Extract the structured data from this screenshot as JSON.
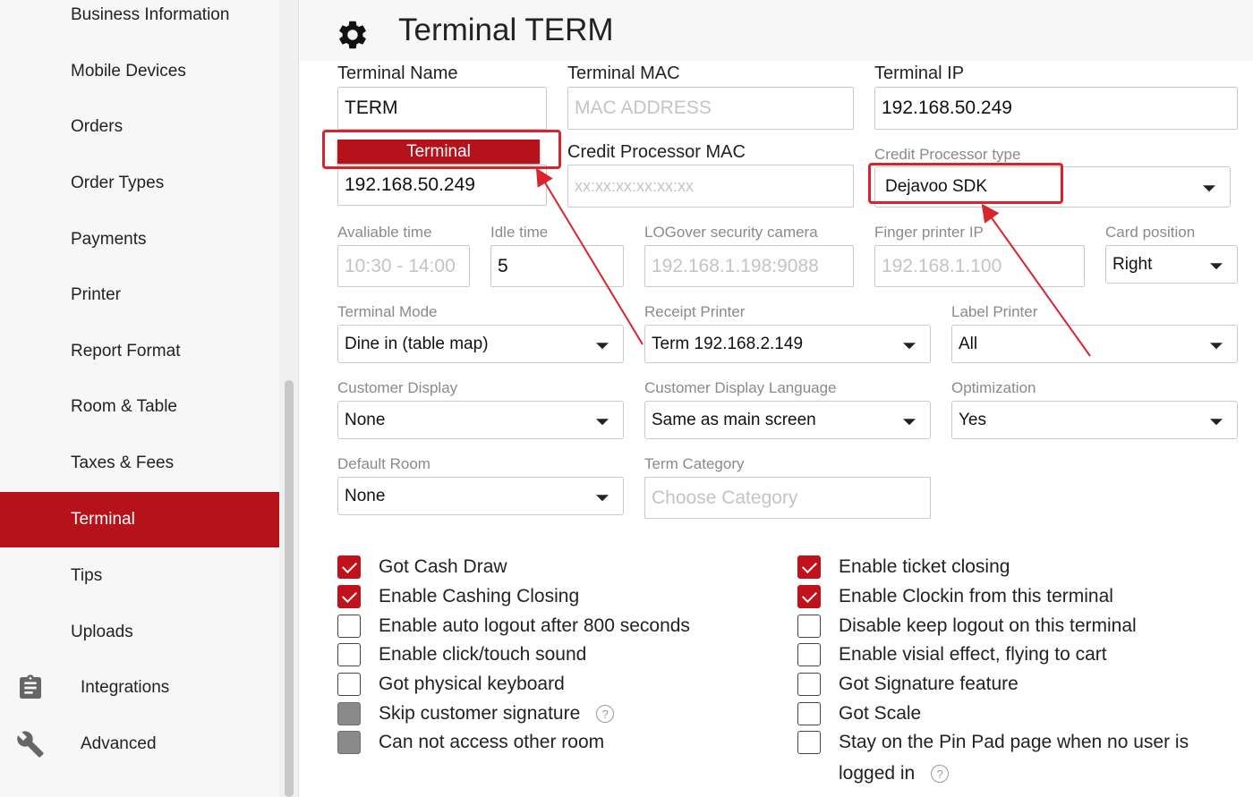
{
  "sidebar": {
    "items": [
      {
        "label": "Business Information"
      },
      {
        "label": "Mobile Devices"
      },
      {
        "label": "Orders"
      },
      {
        "label": "Order Types"
      },
      {
        "label": "Payments"
      },
      {
        "label": "Printer"
      },
      {
        "label": "Report Format"
      },
      {
        "label": "Room & Table"
      },
      {
        "label": "Taxes & Fees"
      },
      {
        "label": "Terminal",
        "active": true
      },
      {
        "label": "Tips"
      },
      {
        "label": "Uploads"
      },
      {
        "label": "Integrations",
        "icon": "clipboard-icon"
      },
      {
        "label": "Advanced",
        "icon": "wrench-icon"
      }
    ]
  },
  "header": {
    "title": "Terminal TERM",
    "icon": "gear-icon"
  },
  "form": {
    "terminal_name": {
      "label": "Terminal Name",
      "value": "TERM"
    },
    "terminal_mac": {
      "label": "Terminal MAC",
      "placeholder": "MAC ADDRESS"
    },
    "terminal_ip": {
      "label": "Terminal IP",
      "value": "192.168.50.249"
    },
    "terminal_button": {
      "label": "Terminal",
      "value": "192.168.50.249"
    },
    "credit_processor_mac": {
      "label": "Credit Processor MAC",
      "placeholder": "xx:xx:xx:xx:xx:xx"
    },
    "credit_processor_type": {
      "label": "Credit Processor type",
      "value": "Dejavoo SDK"
    },
    "available_time": {
      "label": "Avaliable time",
      "placeholder": "10:30 - 14:00"
    },
    "idle_time": {
      "label": "Idle time",
      "value": "5"
    },
    "logover_camera": {
      "label": "LOGover security camera",
      "placeholder": "192.168.1.198:9088"
    },
    "finger_printer_ip": {
      "label": "Finger printer IP",
      "placeholder": "192.168.1.100"
    },
    "card_position": {
      "label": "Card position",
      "value": "Right"
    },
    "terminal_mode": {
      "label": "Terminal Mode",
      "value": "Dine in (table map)"
    },
    "receipt_printer": {
      "label": "Receipt Printer",
      "value": "Term 192.168.2.149"
    },
    "label_printer": {
      "label": "Label Printer",
      "value": "All"
    },
    "customer_display": {
      "label": "Customer Display",
      "value": "None"
    },
    "customer_display_language": {
      "label": "Customer Display Language",
      "value": "Same as main screen"
    },
    "optimization": {
      "label": "Optimization",
      "value": "Yes"
    },
    "default_room": {
      "label": "Default Room",
      "value": "None"
    },
    "term_category": {
      "label": "Term Category",
      "placeholder": "Choose Category"
    }
  },
  "checkboxes_left": [
    {
      "label": "Got Cash Draw",
      "state": "checked"
    },
    {
      "label": "Enable Cashing Closing",
      "state": "checked"
    },
    {
      "label": "Enable auto logout after 800 seconds",
      "state": "unchecked"
    },
    {
      "label": "Enable click/touch sound",
      "state": "unchecked"
    },
    {
      "label": "Got physical keyboard",
      "state": "unchecked"
    },
    {
      "label": "Skip customer signature",
      "state": "disabled",
      "help": "?"
    },
    {
      "label": "Can not access other room",
      "state": "disabled"
    }
  ],
  "checkboxes_right": [
    {
      "label": "Enable ticket closing",
      "state": "checked"
    },
    {
      "label": "Enable Clockin from this terminal",
      "state": "checked"
    },
    {
      "label": "Disable keep logout on this terminal",
      "state": "unchecked"
    },
    {
      "label": "Enable visial effect, flying to cart",
      "state": "unchecked"
    },
    {
      "label": "Got Signature feature",
      "state": "unchecked"
    },
    {
      "label": "Got Scale",
      "state": "unchecked"
    },
    {
      "label": "Stay on the Pin Pad page when no user is",
      "label_line2": "logged in",
      "state": "unchecked",
      "help": "?"
    }
  ],
  "colors": {
    "accent": "#b5121b",
    "annotation": "#d9242d"
  }
}
